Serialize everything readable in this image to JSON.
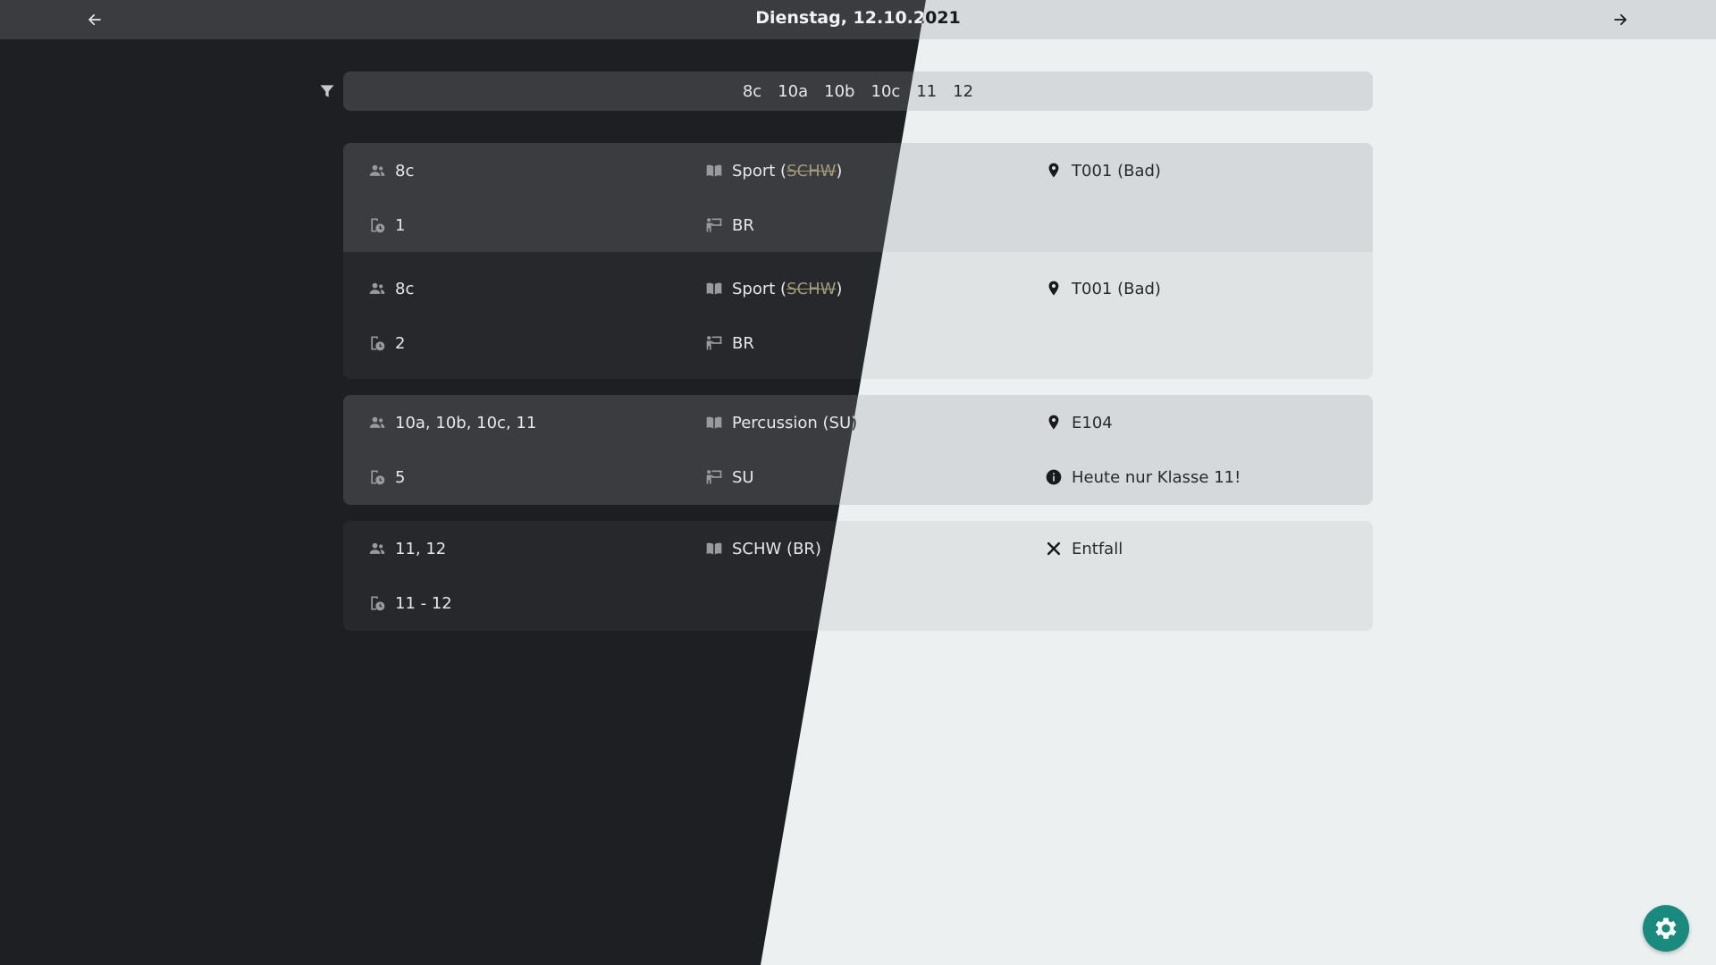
{
  "header": {
    "title": "Dienstag, 12.10.2021",
    "prev_icon": "arrow-left-icon",
    "next_icon": "arrow-right-icon"
  },
  "filter": {
    "icon": "filter-icon",
    "chips": [
      "8c",
      "10a",
      "10b",
      "10c",
      "11",
      "12"
    ]
  },
  "entries": [
    {
      "classes": "8c",
      "subject": "Sport (",
      "subject_struck": "SCHW",
      "subject_end": ")",
      "room": "T001 (Bad)",
      "period": "1",
      "teacher": "BR"
    },
    {
      "classes": "8c",
      "subject": "Sport (",
      "subject_struck": "SCHW",
      "subject_end": ")",
      "room": "T001 (Bad)",
      "period": "2",
      "teacher": "BR"
    },
    {
      "classes": "10a, 10b, 10c, 11",
      "subject": "Percussion (SU)",
      "room": "E104",
      "period": "5",
      "teacher": "SU",
      "info": "Heute nur Klasse 11!"
    },
    {
      "classes": "11, 12",
      "subject": "SCHW (BR)",
      "status": "Entfall",
      "period": "11 - 12"
    }
  ],
  "settings_icon": "gear-icon",
  "colors": {
    "dark_background": "#1d1f22",
    "light_background": "#ecf0f0",
    "accent": "#1a8a7e"
  }
}
